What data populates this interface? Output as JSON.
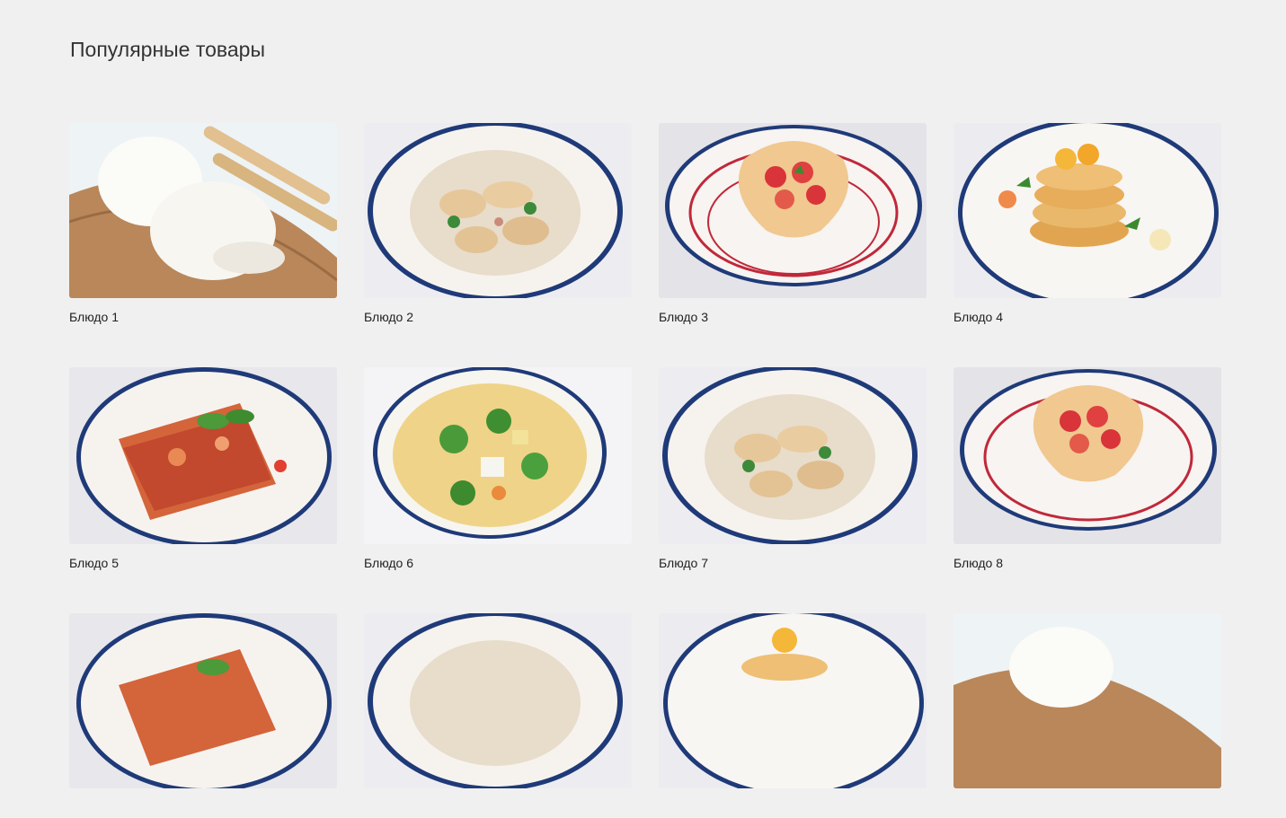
{
  "section": {
    "title": "Популярные товары"
  },
  "products": [
    {
      "name": "Блюдо 1",
      "dish": "burrata-board-image"
    },
    {
      "name": "Блюдо 2",
      "dish": "pelmeni-plate-image"
    },
    {
      "name": "Блюдо 3",
      "dish": "strawberry-basket-image"
    },
    {
      "name": "Блюдо 4",
      "dish": "pancake-stack-image"
    },
    {
      "name": "Блюдо 5",
      "dish": "lasagna-plate-image"
    },
    {
      "name": "Блюдо 6",
      "dish": "vegetable-soup-image"
    },
    {
      "name": "Блюдо 7",
      "dish": "pelmeni-plate-image"
    },
    {
      "name": "Блюдо 8",
      "dish": "strawberry-basket-image"
    },
    {
      "name": "",
      "dish": "lasagna-plate-image"
    },
    {
      "name": "",
      "dish": "pelmeni-plate-image"
    },
    {
      "name": "",
      "dish": "pancake-stack-image"
    },
    {
      "name": "",
      "dish": "burrata-board-image"
    }
  ],
  "colors": {
    "page_background": "#f0f0f0",
    "plate_rim": "#1f3a78",
    "title_text": "#333333"
  }
}
